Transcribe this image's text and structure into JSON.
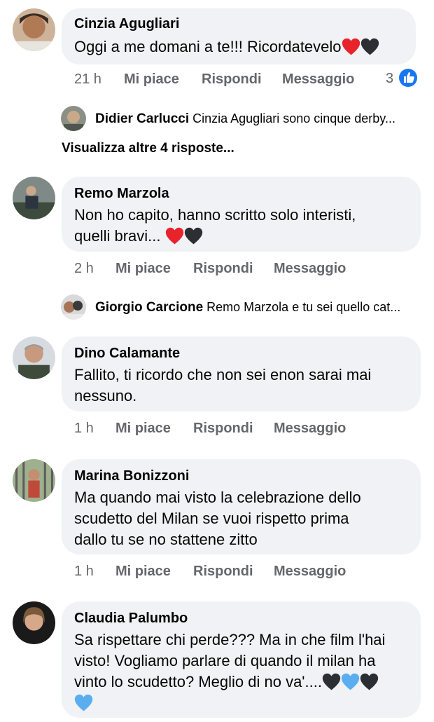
{
  "comments": [
    {
      "name": "Cinzia Agugliari",
      "text": "Oggi a me domani a te!!! Ricordatevelo",
      "emoji": [
        "red-heart",
        "black-heart"
      ],
      "time": "21 h",
      "like": "Mi piace",
      "reply": "Rispondi",
      "message": "Messaggio",
      "reaction_count": "3"
    },
    {
      "name": "Remo Marzola",
      "text_line1": "Non ho capito, hanno scritto solo interisti,",
      "text_line2": "quelli bravi... ",
      "emoji": [
        "red-heart",
        "black-heart"
      ],
      "time": "2 h",
      "like": "Mi piace",
      "reply": "Rispondi",
      "message": "Messaggio"
    },
    {
      "name": "Dino Calamante",
      "text_line1": "Fallito, ti ricordo che non sei enon sarai mai",
      "text_line2": "nessuno.",
      "time": "1 h",
      "like": "Mi piace",
      "reply": "Rispondi",
      "message": "Messaggio"
    },
    {
      "name": "Marina Bonizzoni",
      "text_line1": "Ma quando mai visto la celebrazione dello",
      "text_line2": "scudetto del Milan se vuoi rispetto prima",
      "text_line3": "dallo tu se no stattene zitto",
      "time": "1 h",
      "like": "Mi piace",
      "reply": "Rispondi",
      "message": "Messaggio"
    },
    {
      "name": "Claudia Palumbo",
      "text_line1": "Sa rispettare chi perde??? Ma in che film l'hai",
      "text_line2": "visto! Vogliamo parlare di quando il milan ha",
      "text_line3": "vinto lo scudetto? Meglio di no va'....",
      "emoji": [
        "black-heart",
        "blue-heart",
        "black-heart",
        "blue-heart"
      ]
    }
  ],
  "replies": [
    {
      "name": "Didier Carlucci",
      "text": "Cinzia Agugliari sono cinque derby..."
    },
    {
      "name": "Giorgio Carcione",
      "text": "Remo Marzola e tu sei quello cat..."
    }
  ],
  "more_replies": "Visualizza altre 4 risposte...",
  "colors": {
    "red_heart": "#e8232b",
    "black_heart": "#2b2f33",
    "blue_heart": "#5aaef0",
    "like_blue": "#1877f2",
    "bubble": "#f0f2f5",
    "meta": "#65676b"
  }
}
